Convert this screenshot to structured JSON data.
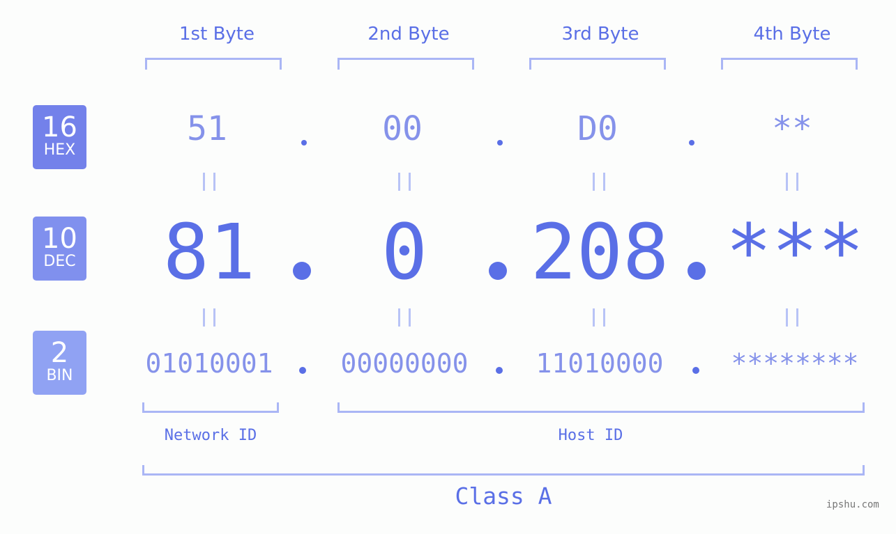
{
  "headers": [
    "1st Byte",
    "2nd Byte",
    "3rd Byte",
    "4th Byte"
  ],
  "badges": {
    "hex": {
      "num": "16",
      "label": "HEX",
      "color": "#7381ea"
    },
    "dec": {
      "num": "10",
      "label": "DEC",
      "color": "#8090ee"
    },
    "bin": {
      "num": "2",
      "label": "BIN",
      "color": "#90a2f3"
    }
  },
  "hex": [
    "51",
    "00",
    "D0",
    "**"
  ],
  "dec": [
    "81",
    "0",
    "208",
    "***"
  ],
  "bin": [
    "01010001",
    "00000000",
    "11010000",
    "********"
  ],
  "labels": {
    "network": "Network ID",
    "host": "Host ID",
    "class": "Class A"
  },
  "watermark": "ipshu.com"
}
